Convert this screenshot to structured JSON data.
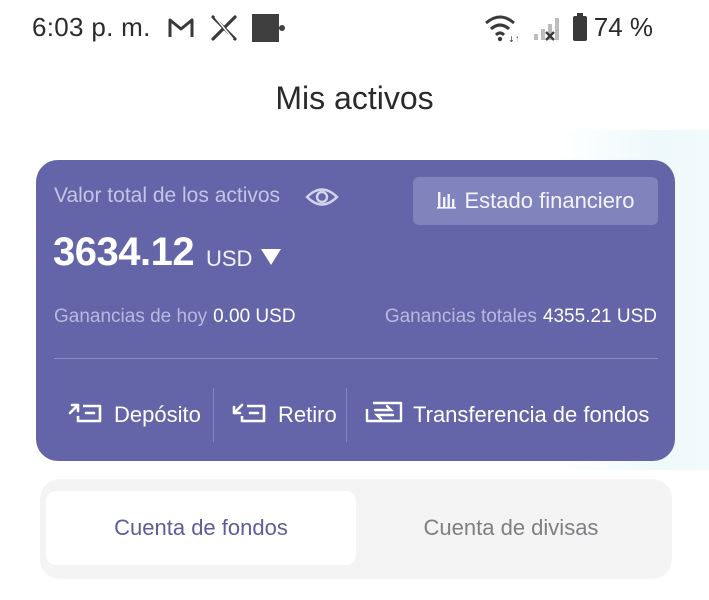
{
  "status_bar": {
    "time": "6:03 p. m.",
    "battery": "74 %",
    "icons": [
      "gmail-icon",
      "x-icon",
      "wallet-icon",
      "wifi-icon",
      "signal-icon",
      "battery-icon"
    ]
  },
  "page": {
    "title": "Mis activos"
  },
  "card": {
    "background": "#6465a8",
    "total_label": "Valor total de los activos",
    "financial_button": "Estado financiero",
    "amount": "3634.12",
    "currency": "USD",
    "today_earnings_label": "Ganancias de hoy",
    "today_earnings_value": "0.00 USD",
    "total_earnings_label": "Ganancias totales",
    "total_earnings_value": "4355.21 USD",
    "actions": {
      "deposit": "Depósito",
      "withdraw": "Retiro",
      "transfer": "Transferencia de fondos"
    }
  },
  "tabs": {
    "funds": "Cuenta de fondos",
    "fx": "Cuenta de divisas",
    "active": "funds"
  }
}
